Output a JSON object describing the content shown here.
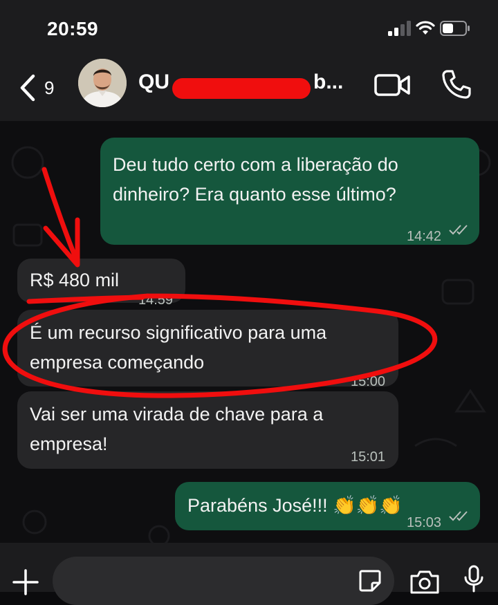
{
  "status_bar": {
    "time": "20:59"
  },
  "header": {
    "back_count": "9",
    "contact_name_start": "QU",
    "contact_name_end": "b...",
    "icons": {
      "back": "chevron-left-icon",
      "video": "video-camera-icon",
      "call": "phone-icon"
    }
  },
  "messages": [
    {
      "direction": "outgoing",
      "text_lines": [
        "Deu tudo certo com a liberação do",
        "dinheiro? Era quanto esse último?"
      ],
      "time": "14:42",
      "status": "read"
    },
    {
      "direction": "incoming",
      "text_lines": [
        "R$ 480 mil"
      ],
      "time": "14:59"
    },
    {
      "direction": "incoming",
      "text_lines": [
        "É um recurso significativo para uma",
        "empresa começando"
      ],
      "time": "15:00"
    },
    {
      "direction": "incoming",
      "text_lines": [
        "Vai ser uma virada de chave para a",
        "empresa!"
      ],
      "time": "15:01"
    },
    {
      "direction": "outgoing",
      "text_lines": [
        "Parabéns José!!! 👏👏👏"
      ],
      "time": "15:03",
      "status": "read"
    }
  ],
  "input_bar": {
    "placeholder": "",
    "icons": {
      "plus": "plus-icon",
      "sticker": "sticker-icon",
      "camera": "camera-icon",
      "mic": "microphone-icon"
    }
  },
  "colors": {
    "bar_background": "#1c1c1e",
    "chat_background": "#0e0e10",
    "outgoing_bubble": "#15573d",
    "incoming_bubble": "#262628",
    "annotation_red": "#f00e0e",
    "redaction_red": "#f00e0e"
  }
}
